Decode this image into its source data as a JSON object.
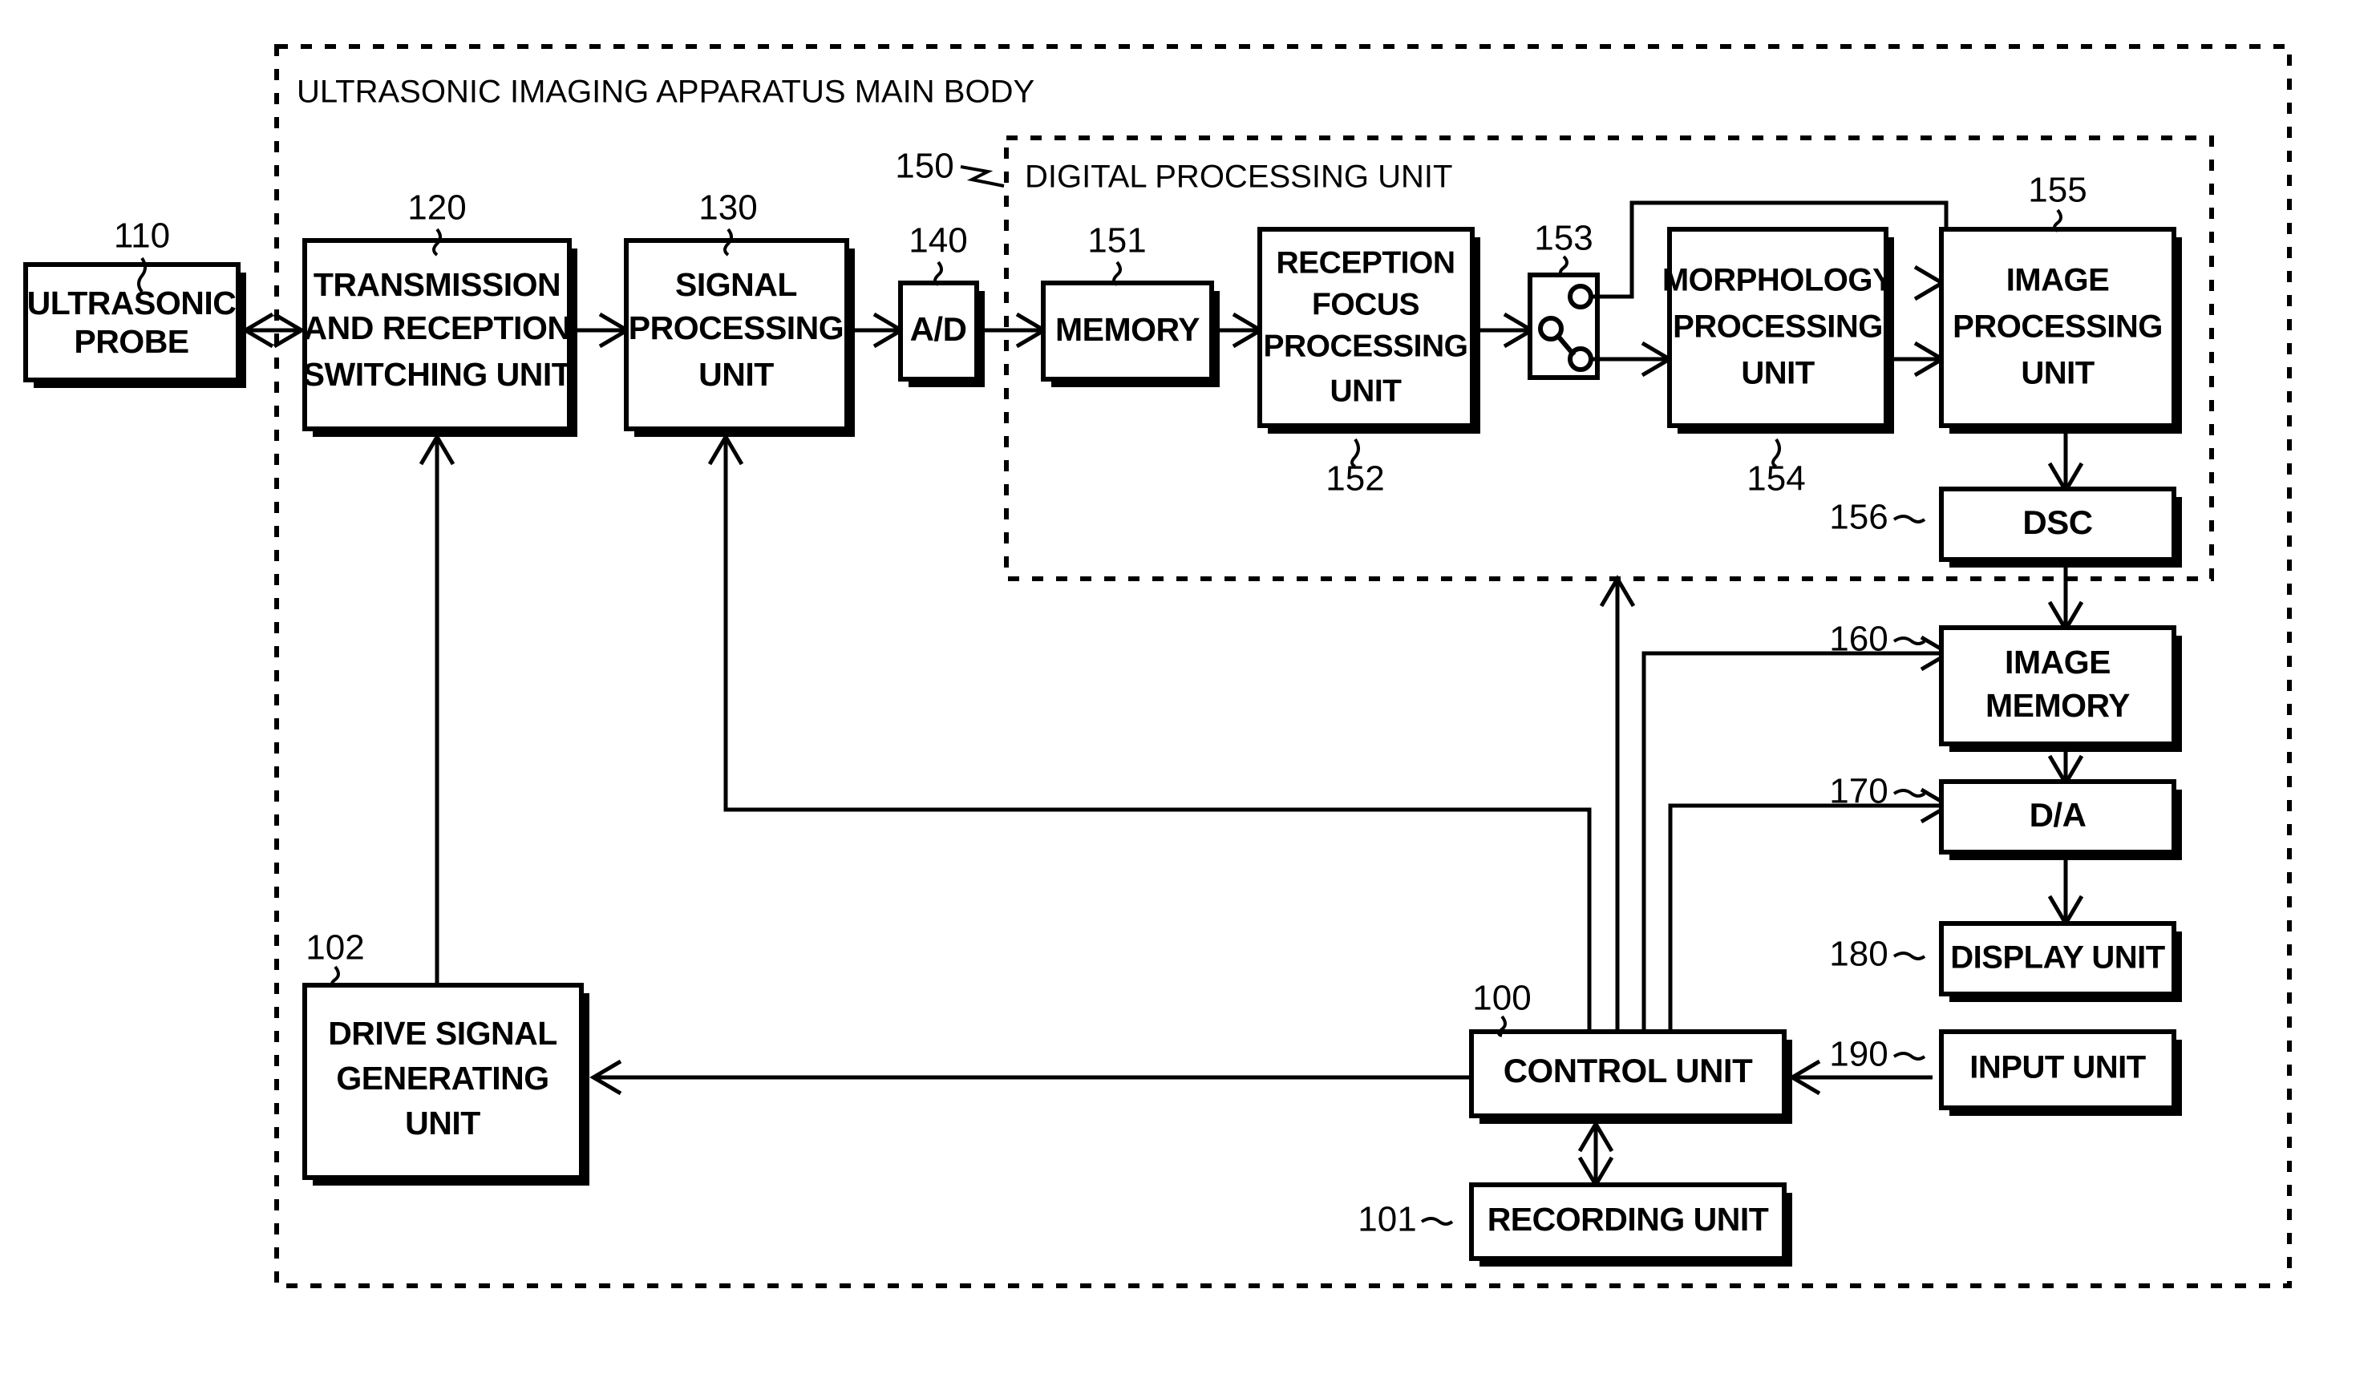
{
  "figure": {
    "title": "ULTRASONIC IMAGING APPARATUS MAIN BODY",
    "subsystem_title": "DIGITAL PROCESSING UNIT",
    "line_color": "#000000",
    "background_color": "#ffffff"
  },
  "blocks": {
    "probe": {
      "label": "ULTRASONIC\nPROBE",
      "ref": "110"
    },
    "txrx": {
      "label": "TRANSMISSION\nAND RECEPTION\nSWITCHING UNIT",
      "ref": "120"
    },
    "signal": {
      "label": "SIGNAL\nPROCESSING\nUNIT",
      "ref": "130"
    },
    "ad": {
      "label": "A/D",
      "ref": "140"
    },
    "memory": {
      "label": "MEMORY",
      "ref": "151"
    },
    "rx_focus": {
      "label": "RECEPTION\nFOCUS\nPROCESSING\nUNIT",
      "ref": "152"
    },
    "switch": {
      "label": "",
      "ref": "153"
    },
    "morphology": {
      "label": "MORPHOLOGY\nPROCESSING\nUNIT",
      "ref": "154"
    },
    "image_proc": {
      "label": "IMAGE\nPROCESSING\nUNIT",
      "ref": "155"
    },
    "dsc": {
      "label": "DSC",
      "ref": "156"
    },
    "image_memory": {
      "label": "IMAGE\nMEMORY",
      "ref": "160"
    },
    "da": {
      "label": "D/A",
      "ref": "170"
    },
    "display": {
      "label": "DISPLAY UNIT",
      "ref": "180"
    },
    "input": {
      "label": "INPUT UNIT",
      "ref": "190"
    },
    "control": {
      "label": "CONTROL UNIT",
      "ref": "100"
    },
    "recording": {
      "label": "RECORDING UNIT",
      "ref": "101"
    },
    "drive": {
      "label": "DRIVE SIGNAL\nGENERATING\nUNIT",
      "ref": "102"
    }
  },
  "subsystem": {
    "ref": "150",
    "label": "DIGITAL PROCESSING UNIT"
  },
  "ref_labels": [
    "110",
    "120",
    "130",
    "140",
    "150",
    "151",
    "152",
    "153",
    "154",
    "155",
    "156",
    "160",
    "170",
    "180",
    "190",
    "100",
    "101",
    "102"
  ]
}
